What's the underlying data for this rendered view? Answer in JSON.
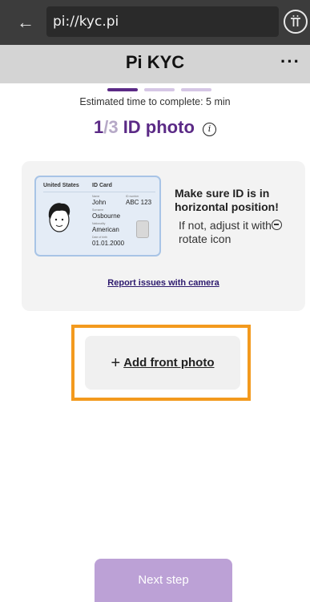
{
  "browser": {
    "back_icon": "arrow-left-icon",
    "url": "pi://kyc.pi",
    "pi_icon": "pi-network-icon"
  },
  "header": {
    "title": "Pi KYC",
    "more_label": "···"
  },
  "progress": {
    "steps_total": 3,
    "current_step": 1,
    "estimated_time": "Estimated time to complete: 5 min"
  },
  "step": {
    "current": "1",
    "total": "/3",
    "name": " ID photo",
    "info_label": "i"
  },
  "id_example": {
    "country": "United States",
    "type": "ID Card",
    "name_label": "Name",
    "name": "John",
    "number_label": "ID number",
    "number": "ABC 123",
    "surname_label": "Surname",
    "surname": "Osbourne",
    "nationality_label": "Nationality",
    "nationality": "American",
    "dob_label": "Date of birth",
    "dob": "01.01.2000"
  },
  "hint": {
    "title": "Make sure ID is in horizontal position!",
    "text_before": "If not, adjust it with",
    "text_after": " rotate icon"
  },
  "report_link": "Report issues with camera",
  "add_photo": {
    "plus": "+",
    "label": "Add front photo"
  },
  "next_button": "Next step",
  "colors": {
    "accent": "#5b2a86",
    "progress_active": "#5b2a86",
    "progress_inactive": "#d5c6e5",
    "highlight": "#f39a1e",
    "next_button": "#bca1d6"
  }
}
